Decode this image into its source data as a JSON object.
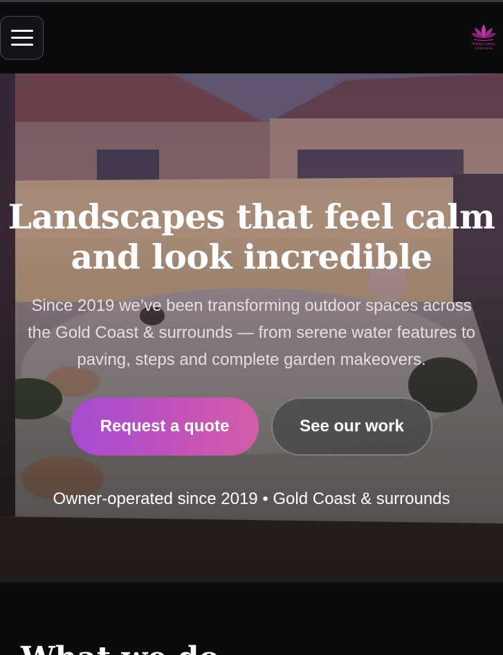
{
  "header": {
    "menu_label": "Menu",
    "logo": {
      "name": "White Lotus",
      "sub": "Landscaping",
      "color": "#c23aa8"
    }
  },
  "hero": {
    "title_line1": "Landscapes that feel calm",
    "title_line2": "and look incredible",
    "subtitle_line1": "Since 2019 we’ve been transforming outdoor spaces across",
    "subtitle_line2": "the Gold Coast & surrounds — from serene water features to",
    "subtitle_line3": "paving, steps and complete garden makeovers.",
    "primary_button": "Request a quote",
    "secondary_button": "See our work",
    "tagline": "Owner-operated since 2019 • Gold Coast & surrounds"
  },
  "section": {
    "title": "What we do"
  },
  "colors": {
    "accent_start": "#a44bd0",
    "accent_end": "#d45ea8",
    "background": "#0b0a0d"
  }
}
